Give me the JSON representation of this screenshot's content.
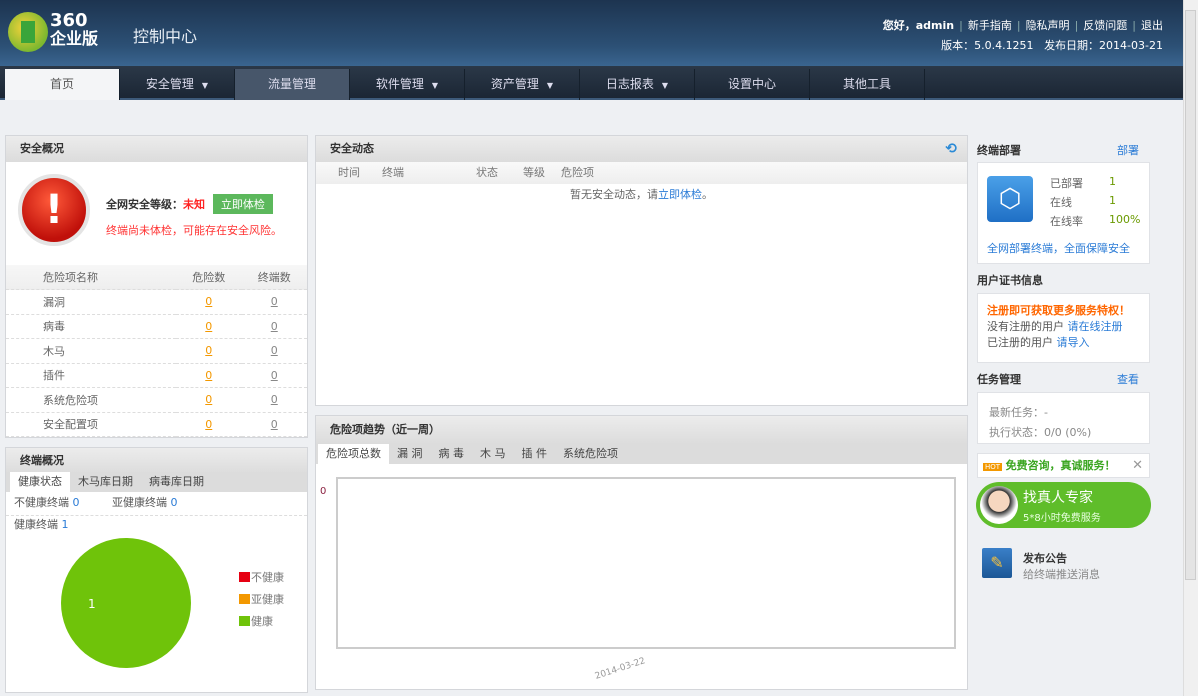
{
  "header": {
    "brand_line1": "360",
    "brand_line2": "企业版",
    "title": "控制中心",
    "greeting": "您好，admin",
    "links": [
      "新手指南",
      "隐私声明",
      "反馈问题",
      "退出"
    ],
    "version": "版本：5.0.4.1251",
    "release": "发布日期：2014-03-21"
  },
  "nav": [
    {
      "label": "首页",
      "dropdown": false
    },
    {
      "label": "安全管理",
      "dropdown": true
    },
    {
      "label": "流量管理",
      "dropdown": false
    },
    {
      "label": "软件管理",
      "dropdown": true
    },
    {
      "label": "资产管理",
      "dropdown": true
    },
    {
      "label": "日志报表",
      "dropdown": true
    },
    {
      "label": "设置中心",
      "dropdown": false
    },
    {
      "label": "其他工具",
      "dropdown": false
    }
  ],
  "overview": {
    "title": "安全概况",
    "level_label": "全网安全等级：",
    "level_value": "未知",
    "check_button": "立即体检",
    "warning": "终端尚未体检，可能存在安全风险。",
    "columns": [
      "危险项名称",
      "危险数",
      "终端数"
    ],
    "rows": [
      {
        "name": "漏洞",
        "risk": "0",
        "terminals": "0"
      },
      {
        "name": "病毒",
        "risk": "0",
        "terminals": "0"
      },
      {
        "name": "木马",
        "risk": "0",
        "terminals": "0"
      },
      {
        "name": "插件",
        "risk": "0",
        "terminals": "0"
      },
      {
        "name": "系统危险项",
        "risk": "0",
        "terminals": "0"
      },
      {
        "name": "安全配置项",
        "risk": "0",
        "terminals": "0"
      }
    ]
  },
  "dynamics": {
    "title": "安全动态",
    "columns": [
      "时间",
      "终端",
      "状态",
      "等级",
      "危险项"
    ],
    "empty_prefix": "暂无安全动态，请",
    "empty_link": "立即体检",
    "empty_suffix": "。"
  },
  "trend": {
    "title": "危险项趋势（近一周）",
    "tabs": [
      "危险项总数",
      "漏 洞",
      "病 毒",
      "木 马",
      "插 件",
      "系统危险项"
    ]
  },
  "terminal": {
    "title": "终端概况",
    "tabs": [
      "健康状态",
      "木马库日期",
      "病毒库日期"
    ],
    "stats": [
      {
        "label": "不健康终端",
        "value": "0"
      },
      {
        "label": "亚健康终端",
        "value": "0"
      },
      {
        "label": "健康终端",
        "value": "1"
      }
    ]
  },
  "chart_data": [
    {
      "type": "pie",
      "categories": [
        "不健康",
        "亚健康",
        "健康"
      ],
      "values": [
        0,
        0,
        1
      ],
      "colors": [
        "#e60012",
        "#f39800",
        "#6fc30a"
      ],
      "legend": "right",
      "data_label": "1"
    },
    {
      "type": "line",
      "x": [
        "2014-03-22"
      ],
      "values": [
        0
      ],
      "y_ticks": [
        "0"
      ],
      "grid": false
    }
  ],
  "deploy": {
    "title": "终端部署",
    "action": "部署",
    "rows": [
      {
        "label": "已部署",
        "value": "1"
      },
      {
        "label": "在线",
        "value": "1"
      },
      {
        "label": "在线率",
        "value": "100%"
      }
    ],
    "link": "全网部署终端，全面保障安全"
  },
  "cert": {
    "title": "用户证书信息",
    "promo": "注册即可获取更多服务特权！",
    "line1": "没有注册的用户",
    "link1": "请在线注册",
    "line2": "已注册的用户",
    "link2": "请导入"
  },
  "task": {
    "title": "任务管理",
    "action": "查看",
    "latest": "最新任务：-",
    "status": "执行状态：0/0 (0%)"
  },
  "consult": {
    "badge": "HOT",
    "text": "免费咨询，真诚服务！",
    "expert": "找真人专家",
    "hours": "5*8小时免费服务"
  },
  "notice": {
    "title": "发布公告",
    "subtitle": "给终端推送消息"
  }
}
